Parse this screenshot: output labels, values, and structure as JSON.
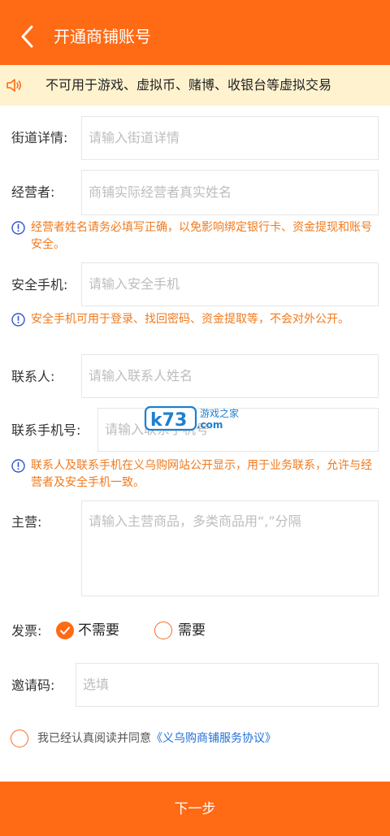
{
  "header": {
    "title": "开通商铺账号",
    "back_icon": "chevron-left-icon"
  },
  "notice": {
    "icon": "speaker-icon",
    "text": "不可用于游戏、虚拟币、赌博、收银台等虚拟交易"
  },
  "form": {
    "street": {
      "label": "街道详情:",
      "placeholder": "请输入街道详情"
    },
    "operator": {
      "label": "经营者:",
      "placeholder": "商铺实际经营者真实姓名"
    },
    "operator_hint": "经营者姓名请务必填写正确，以免影响绑定银行卡、资金提现和账号安全。",
    "phone": {
      "label": "安全手机:",
      "placeholder": "请输入安全手机"
    },
    "phone_hint": "安全手机可用于登录、找回密码、资金提取等，不会对外公开。",
    "contact": {
      "label": "联系人:",
      "placeholder": "请输入联系人姓名"
    },
    "contact_phone": {
      "label": "联系手机号:",
      "placeholder": "请输入联系手机号"
    },
    "contact_hint": "联系人及联系手机在义乌购网站公开显示，用于业务联系，允许与经营者及安全手机一致。",
    "main_business": {
      "label": "主营:",
      "placeholder": "请输入主营商品，多类商品用“,”分隔"
    },
    "invoice": {
      "label": "发票:",
      "option_no": "不需要",
      "option_yes": "需要",
      "selected": "不需要"
    },
    "invite": {
      "label": "邀请码:",
      "placeholder": "选填"
    }
  },
  "agreement": {
    "prefix": "我已经认真阅读并同意",
    "link": "《义乌购商铺服务协议》",
    "checked": false
  },
  "footer": {
    "next_label": "下一步"
  },
  "watermark": {
    "text": "k73",
    "sub": "游戏之家",
    "domain": ".com"
  },
  "colors": {
    "accent": "#ff6a15",
    "notice_bg": "#fff3cf",
    "hint": "#f07a1e",
    "link": "#1f6fd9"
  }
}
